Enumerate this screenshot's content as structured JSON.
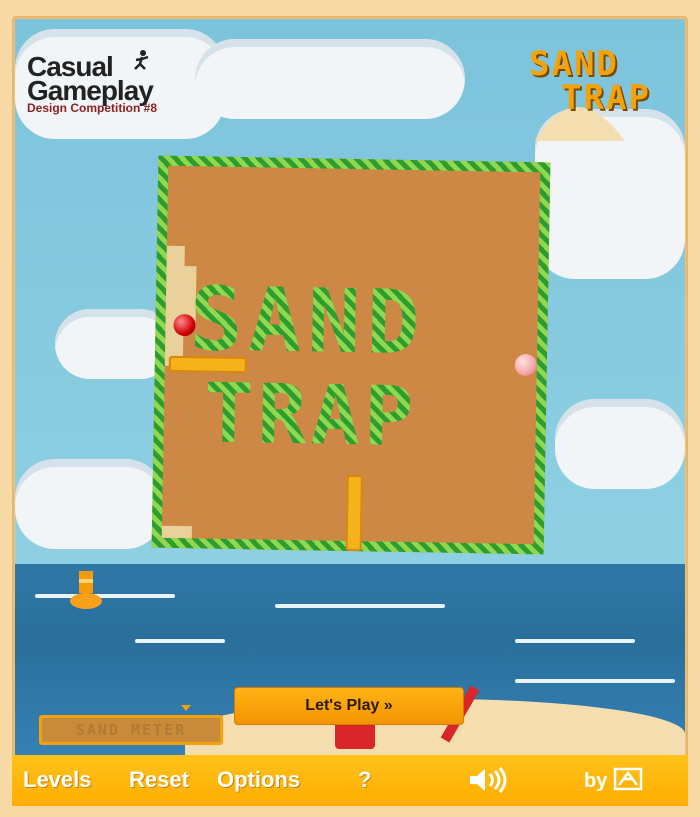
{
  "branding": {
    "line1": "Casual",
    "line2": "Gameplay",
    "subtitle": "Design Competition #8"
  },
  "game_logo": {
    "line1": "SAND",
    "line2": "TRAP"
  },
  "board_text": {
    "line1": "SAND",
    "line2": "TRAP"
  },
  "meter": {
    "label": "SAND METER"
  },
  "play_button": {
    "label": "Let's Play »"
  },
  "menu": {
    "levels": "Levels",
    "reset": "Reset",
    "options": "Options",
    "help": "?",
    "by": "by"
  },
  "colors": {
    "accent": "#ffad00",
    "board_stripe_light": "#8ed94f",
    "board_stripe_dark": "#2e9c2e",
    "board_fill": "#cc8844"
  },
  "icons": {
    "sound": "speaker-icon",
    "publisher": "publisher-logo-icon"
  }
}
